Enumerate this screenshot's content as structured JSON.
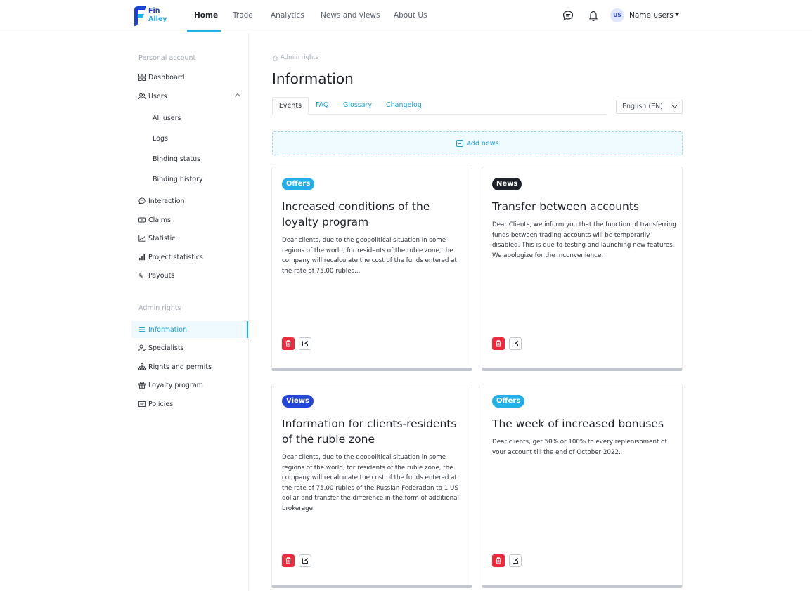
{
  "brand": {
    "line1": "Fin",
    "line2": "Alley"
  },
  "nav": {
    "items": [
      "Home",
      "Trade",
      "Analytics",
      "News and views",
      "About Us"
    ],
    "active_index": 0,
    "chat_icon": "chat-icon",
    "bell_icon": "bell-icon"
  },
  "user": {
    "initials": "US",
    "name": "Name users"
  },
  "sidebar": {
    "section_personal": "Personal account",
    "section_admin": "Admin rights",
    "personal_items": [
      {
        "label": "Dashboard",
        "icon": "grid-icon"
      },
      {
        "label": "Users",
        "icon": "users-icon"
      },
      {
        "label": "All users"
      },
      {
        "label": "Logs"
      },
      {
        "label": "Binding status"
      },
      {
        "label": "Binding history"
      },
      {
        "label": "Interaction",
        "icon": "chat-bubble-icon"
      },
      {
        "label": "Claims",
        "icon": "ticket-icon"
      },
      {
        "label": "Statistic",
        "icon": "line-chart-icon"
      },
      {
        "label": "Project statistics",
        "icon": "bar-chart-icon"
      },
      {
        "label": "Payouts",
        "icon": "payout-icon"
      }
    ],
    "admin_items": [
      {
        "label": "Information",
        "icon": "list-icon"
      },
      {
        "label": "Specialists",
        "icon": "specialist-icon"
      },
      {
        "label": "Rights and permits",
        "icon": "hierarchy-icon"
      },
      {
        "label": "Loyalty program",
        "icon": "gift-icon"
      },
      {
        "label": "Policies",
        "icon": "document-icon"
      }
    ]
  },
  "main": {
    "breadcrumb": "Admin rights",
    "title": "Information",
    "tabs": [
      "Events",
      "FAQ",
      "Glossary",
      "Changelog"
    ],
    "active_tab": 0,
    "language": "English (EN)",
    "add_news": "Add news",
    "cards": [
      {
        "badge": "Offers",
        "badge_color": "#22aee6",
        "title": "Increased conditions of the loyalty program",
        "body": "Dear clients, due to the geopolitical situation in some regions of the world, for residents of the ruble zone, the company will recalculate the cost of the funds entered at the rate of 75.00 rubles..."
      },
      {
        "badge": "News",
        "badge_color": "#1f2329",
        "title": "Transfer between accounts",
        "body": "Dear Clients, we inform you that the function of transferring funds between trading accounts will be temporarily disabled. This is due to testing and launching new features. We apologize for the inconvenience."
      },
      {
        "badge": "Views",
        "badge_color": "#2446d8",
        "title": "Information for clients-residents of the ruble zone",
        "body": "Dear clients, due to the geopolitical situation in some regions of the world, for residents of the ruble zone, the company will recalculate the cost of the funds entered at the rate of 75.00 rubles of the Russian Federation to 1 US dollar and transfer the difference in the form of additional brokerage"
      },
      {
        "badge": "Offers",
        "badge_color": "#22aee6",
        "title": "The week of increased bonuses",
        "body": "Dear clients, get 50% or 100% to every replenishment of your account till the end of October 2022."
      }
    ]
  }
}
